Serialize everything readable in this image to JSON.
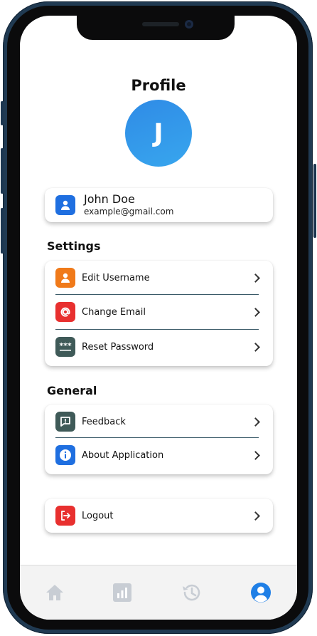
{
  "header": {
    "title": "Profile"
  },
  "avatar": {
    "initial": "J"
  },
  "user": {
    "name": "John Doe",
    "email": "example@gmail.com",
    "icon": "person-icon"
  },
  "settings": {
    "title": "Settings",
    "items": [
      {
        "label": "Edit Username",
        "icon": "person-icon",
        "color": "#f07a1a"
      },
      {
        "label": "Change Email",
        "icon": "at-sign-icon",
        "color": "#e8302f"
      },
      {
        "label": "Reset Password",
        "icon": "password-icon",
        "color": "#3f5a58"
      }
    ]
  },
  "general": {
    "title": "General",
    "items": [
      {
        "label": "Feedback",
        "icon": "feedback-icon",
        "color": "#3f5a58"
      },
      {
        "label": "About Application",
        "icon": "info-icon",
        "color": "#1f6fe0"
      }
    ]
  },
  "logout": {
    "label": "Logout",
    "icon": "logout-icon",
    "color": "#e8302f"
  },
  "bottom_nav": {
    "items": [
      {
        "name": "home",
        "icon": "home-icon",
        "active": false
      },
      {
        "name": "stats",
        "icon": "bar-chart-icon",
        "active": false
      },
      {
        "name": "history",
        "icon": "history-icon",
        "active": false
      },
      {
        "name": "profile",
        "icon": "profile-icon",
        "active": true
      }
    ],
    "active_color": "#1f7fe6",
    "inactive_color": "#c8cdd4"
  }
}
